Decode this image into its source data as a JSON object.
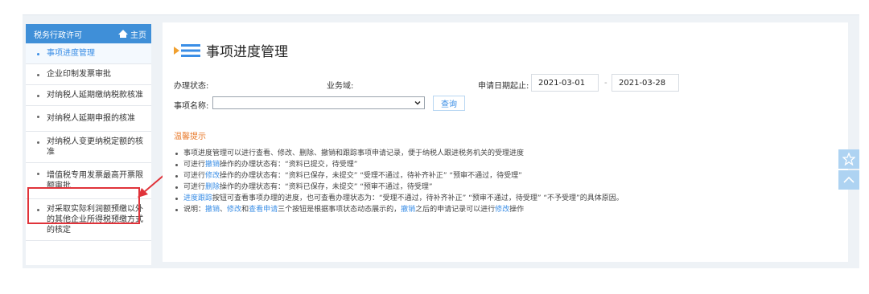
{
  "sidebar": {
    "header_title": "税务行政许可",
    "home_label": "主页",
    "items": [
      {
        "label": "事项进度管理"
      },
      {
        "label": "企业印制发票审批"
      },
      {
        "label": "对纳税人延期缴纳税款核准"
      },
      {
        "label": "对纳税人延期申报的核准"
      },
      {
        "label": "对纳税人变更纳税定额的核准"
      },
      {
        "label": "增值税专用发票最高开票限额审批"
      },
      {
        "label": "对采取实际利润额预缴以外的其他企业所得税预缴方式的核定"
      }
    ]
  },
  "main": {
    "title": "事项进度管理",
    "filters": {
      "status_label": "办理状态:",
      "domain_label": "业务域:",
      "date_label": "申请日期起止:",
      "date_from": "2021-03-01",
      "date_sep": "-",
      "date_to": "2021-03-28",
      "item_name_label": "事项名称:",
      "item_name_value": "",
      "query_label": "查询"
    },
    "tips_title": "温馨提示",
    "tips": {
      "t1": "事项进度管理可以进行查看、修改、删除、撤销和跟踪事项申请记录，便于纳税人跟进税务机关的受理进度",
      "t2_pre": "可进行",
      "t2_link": "撤销",
      "t2_post": "操作的办理状态有：“资料已提交，待受理”",
      "t3_pre": "可进行",
      "t3_link": "修改",
      "t3_post": "操作的办理状态有：“资料已保存，未提交” “受理不通过，待补齐补正” “预审不通过，待受理”",
      "t4_pre": "可进行",
      "t4_link": "删除",
      "t4_post": "操作的办理状态有：“资料已保存，未提交” “预审不通过，待受理”",
      "t5_link": "进度跟踪",
      "t5_post": "按钮可查看事项办理的进度，也可查看办理状态为：“受理不通过，待补齐补正” “预审不通过，待受理” “不予受理”的具体原因。",
      "t6_pre": "说明：",
      "t6_l1": "撤销",
      "t6_s1": "、",
      "t6_l2": "修改",
      "t6_s2": "和",
      "t6_l3": "查看申请",
      "t6_mid": "三个按钮是根据事项状态动态展示的，",
      "t6_l4": "撤销",
      "t6_mid2": "之后的申请记录可以进行",
      "t6_l5": "修改",
      "t6_end": "操作"
    }
  },
  "colors": {
    "accent": "#3f8fd8",
    "link": "#3a8ee6",
    "tips_title": "#e8792a",
    "highlight": "#e0333a"
  },
  "icons": [
    "home-icon",
    "list-icon",
    "chevron-down-icon",
    "star-icon",
    "chevron-up-icon"
  ]
}
